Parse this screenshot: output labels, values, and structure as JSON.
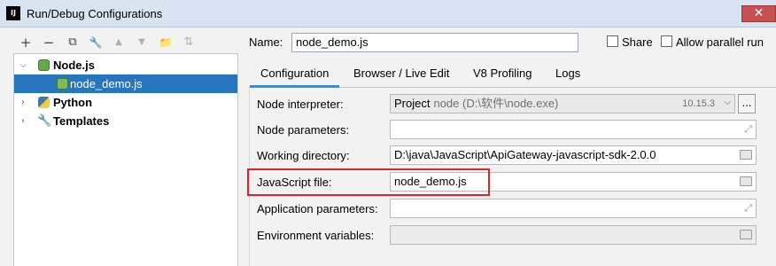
{
  "window": {
    "app_icon_text": "IJ",
    "title": "Run/Debug Configurations",
    "close_symbol": "✕"
  },
  "left_toolbar": [
    {
      "name": "add-button",
      "symbol": "+",
      "icon": "plus-icon",
      "enabled": true
    },
    {
      "name": "remove-button",
      "symbol": "−",
      "icon": "minus-icon",
      "enabled": true
    },
    {
      "name": "copy-button",
      "symbol": "⧉",
      "icon": "copy-icon",
      "enabled": true
    },
    {
      "name": "edit-defaults-button",
      "symbol": "🔧",
      "icon": "wrench-icon",
      "enabled": true
    },
    {
      "name": "move-up-button",
      "symbol": "▲",
      "icon": "arrow-up-icon",
      "enabled": false
    },
    {
      "name": "move-down-button",
      "symbol": "▼",
      "icon": "arrow-down-icon",
      "enabled": false
    },
    {
      "name": "new-folder-button",
      "symbol": "📁",
      "icon": "folder-icon",
      "enabled": true
    },
    {
      "name": "sort-button",
      "symbol": "⇅",
      "icon": "sort-icon",
      "enabled": false
    }
  ],
  "tree": {
    "nodejs": {
      "label": "Node.js",
      "icon": "nodejs-icon",
      "expanded": true
    },
    "node_demo": {
      "label": "node_demo.js",
      "icon": "nodejs-icon",
      "selected": true
    },
    "python": {
      "label": "Python",
      "icon": "python-icon",
      "expanded": false
    },
    "templates": {
      "label": "Templates",
      "icon": "wrench-icon",
      "expanded": false
    }
  },
  "header": {
    "name_label": "Name:",
    "name_value": "node_demo.js",
    "share_label": "Share",
    "share_checked": false,
    "parallel_label": "Allow parallel run",
    "parallel_checked": false
  },
  "tabs": [
    {
      "label": "Configuration",
      "active": true
    },
    {
      "label": "Browser / Live Edit",
      "active": false
    },
    {
      "label": "V8 Profiling",
      "active": false
    },
    {
      "label": "Logs",
      "active": false
    }
  ],
  "form": {
    "node_interpreter": {
      "label": "Node interpreter:",
      "kind": "Project",
      "path": "node (D:\\软件\\node.exe)",
      "version": "10.15.3",
      "browse_label": "..."
    },
    "node_parameters": {
      "label": "Node parameters:",
      "value": ""
    },
    "working_directory": {
      "label": "Working directory:",
      "value": "D:\\java\\JavaScript\\ApiGateway-javascript-sdk-2.0.0"
    },
    "javascript_file": {
      "label": "JavaScript file:",
      "value": "node_demo.js"
    },
    "application_parameters": {
      "label": "Application parameters:",
      "value": ""
    },
    "environment_variables": {
      "label": "Environment variables:",
      "value": ""
    }
  },
  "colors": {
    "selection": "#2675bf",
    "highlight_box": "#d9262b",
    "tab_underline": "#4a88c7"
  }
}
